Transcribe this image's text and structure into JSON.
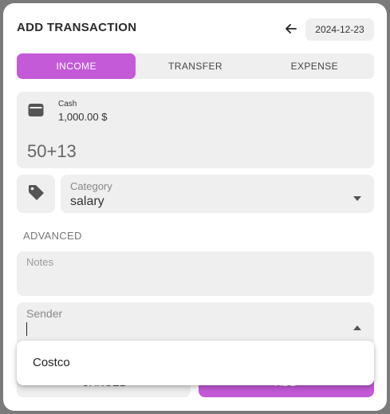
{
  "header": {
    "title": "ADD TRANSACTION",
    "date": "2024-12-23"
  },
  "tabs": [
    {
      "label": "INCOME",
      "active": true
    },
    {
      "label": "TRANSFER",
      "active": false
    },
    {
      "label": "EXPENSE",
      "active": false
    }
  ],
  "account": {
    "name": "Cash",
    "balance": "1,000.00 $",
    "amount_expression": "50+13",
    "icon": "wallet-icon"
  },
  "category": {
    "label": "Category",
    "value": "salary",
    "icon": "tag-icon"
  },
  "advanced": {
    "heading": "ADVANCED",
    "notes_placeholder": "Notes",
    "sender_label": "Sender",
    "sender_value": ""
  },
  "footer": {
    "cancel_label": "CANCEL",
    "add_label": "ADD"
  },
  "dropdown": {
    "options": [
      "Costco"
    ]
  },
  "colors": {
    "accent": "#c45ad8",
    "field_bg": "#efefef"
  }
}
